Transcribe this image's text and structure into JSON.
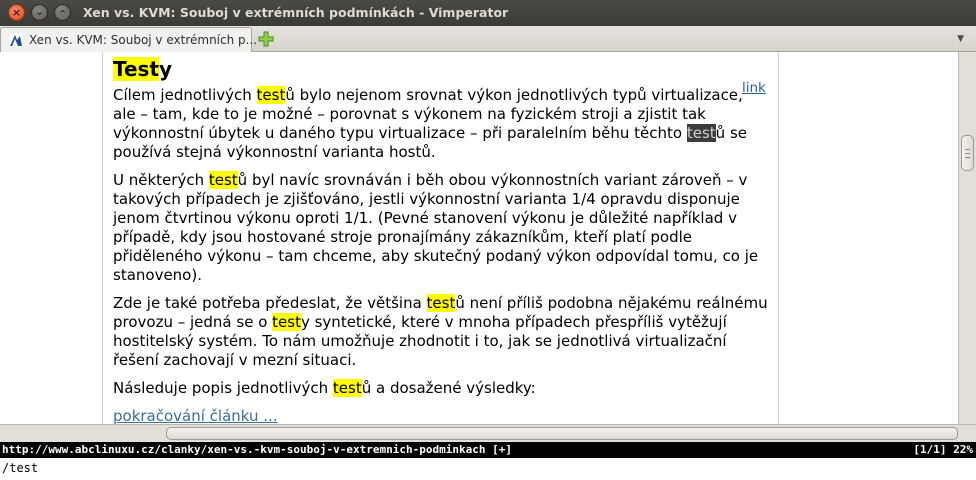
{
  "window": {
    "title": "Xen vs. KVM: Souboj v extrémních podmínkách - Vimperator"
  },
  "tabs": [
    {
      "label": "Xen vs. KVM: Souboj v extrémních p...",
      "active": true
    }
  ],
  "article": {
    "heading_hl": "Test",
    "heading_rest": "y",
    "anchor_link": "link",
    "p1": {
      "a": "Cílem jednotlivých ",
      "hl1": "test",
      "b": "ů bylo nejenom srovnat výkon jednotlivých typů virtualizace, ale – tam, kde to je možné – porovnat s výkonem na fyzickém stroji a zjistit tak výkonnostní úbytek u daného typu virtualizace – při paralelním běhu těchto ",
      "hl2": "test",
      "c": "ů se používá stejná výkonnostní varianta hostů."
    },
    "p2": {
      "a": "U některých ",
      "hl1": "test",
      "b": "ů byl navíc srovnáván i běh obou výkonnostních variant zároveň – v takových případech je zjišťováno, jestli výkonnostní varianta 1/4 opravdu disponuje jenom čtvrtinou výkonu oproti 1/1. (Pevné stanovení výkonu je důležité například v případě, kdy jsou hostované stroje pronajímány zákazníkům, kteří platí podle přiděleného výkonu – tam chceme, aby skutečný podaný výkon odpovídal tomu, co je stanoveno)."
    },
    "p3": {
      "a": "Zde je také potřeba předeslat, že většina ",
      "hl1": "test",
      "b": "ů není příliš podobna nějakému reálnému provozu – jedná se o ",
      "hl2": "test",
      "c": "y syntetické, které v mnoha případech přespříliš vytěžují hostitelský systém. To nám umožňuje zhodnotit i to, jak se jednotlivá virtualizační řešení zachovají v mezní situaci."
    },
    "p4": {
      "a": "Následuje popis jednotlivých ",
      "hl1": "test",
      "b": "ů a dosažené výsledky:"
    },
    "more_link": "pokračování článku ..."
  },
  "statusline": {
    "url": "http://www.abclinuxu.cz/clanky/xen-vs.-kvm-souboj-v-extremnich-podminkach [+]",
    "position": "[1/1] 22%"
  },
  "cmdline": {
    "value": "/test"
  },
  "colors": {
    "search_highlight": "#ffff00",
    "active_match": "#3c3c3c",
    "link": "#27628f"
  },
  "icons": [
    "close-icon",
    "minimize-icon",
    "maximize-icon",
    "site-favicon",
    "new-tab-plus-icon",
    "tab-scroll-right-icon"
  ]
}
